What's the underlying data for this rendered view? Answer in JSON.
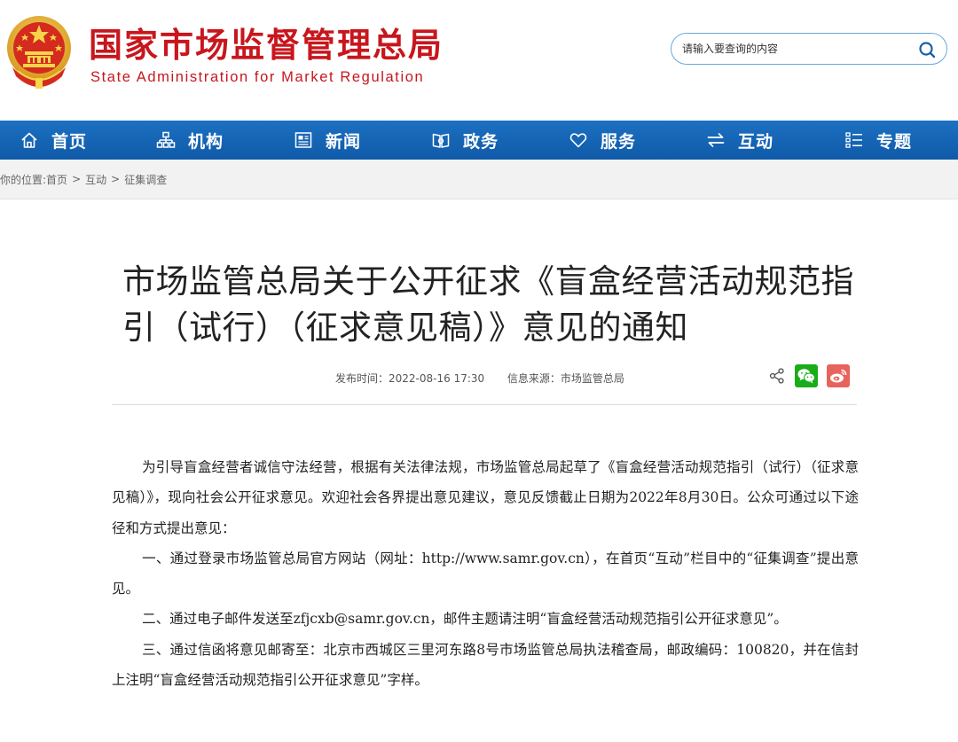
{
  "header": {
    "title": "国家市场监督管理总局",
    "subtitle": "State Administration for Market Regulation",
    "search_placeholder": "请输入要查询的内容",
    "brand_color": "#c8161d"
  },
  "nav": {
    "background": "#1565b4",
    "items": [
      {
        "label": "首页",
        "icon": "home-icon"
      },
      {
        "label": "机构",
        "icon": "org-chart-icon"
      },
      {
        "label": "新闻",
        "icon": "newspaper-icon"
      },
      {
        "label": "政务",
        "icon": "book-icon"
      },
      {
        "label": "服务",
        "icon": "heart-icon"
      },
      {
        "label": "互动",
        "icon": "swap-arrows-icon"
      },
      {
        "label": "专题",
        "icon": "list-icon"
      }
    ]
  },
  "breadcrumb": {
    "prefix": "你的位置:",
    "items": [
      "首页",
      "互动",
      "征集调查"
    ],
    "separator": ">"
  },
  "article": {
    "title": "市场监管总局关于公开征求《盲盒经营活动规范指引（试行）（征求意见稿）》意见的通知",
    "publish_label": "发布时间：",
    "publish_time": "2022-08-16 17:30",
    "source_label": "信息来源：",
    "source": "市场监管总局",
    "share_icons": [
      "share-icon",
      "wechat-icon",
      "weibo-icon"
    ],
    "paragraphs": [
      "为引导盲盒经营者诚信守法经营，根据有关法律法规，市场监管总局起草了《盲盒经营活动规范指引（试行）（征求意见稿）》，现向社会公开征求意见。欢迎社会各界提出意见建议，意见反馈截止日期为2022年8月30日。公众可通过以下途径和方式提出意见：",
      "一、通过登录市场监管总局官方网站（网址：http://www.samr.gov.cn），在首页“互动”栏目中的“征集调查”提出意见。",
      "二、通过电子邮件发送至zfjcxb@samr.gov.cn，邮件主题请注明“盲盒经营活动规范指引公开征求意见”。",
      "三、通过信函将意见邮寄至：北京市西城区三里河东路8号市场监管总局执法稽查局，邮政编码：100820，并在信封上注明“盲盒经营活动规范指引公开征求意见”字样。"
    ]
  }
}
